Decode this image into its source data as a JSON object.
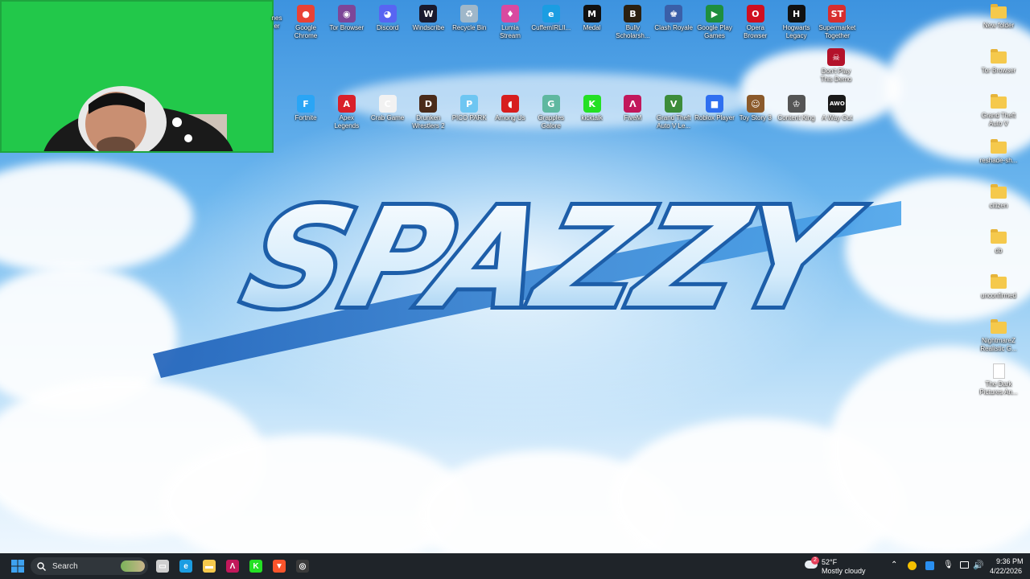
{
  "wallpaper": {
    "logo_text": "SPAZZY"
  },
  "desktop_icons_row1": [
    {
      "label": "Google\nChrome",
      "icon": "chrome-icon",
      "color": "#e94235",
      "glyph": "●"
    },
    {
      "label": "Tor Browser",
      "icon": "tor-icon",
      "color": "#7d4698",
      "glyph": "◉"
    },
    {
      "label": "Discord",
      "icon": "discord-icon",
      "color": "#5865f2",
      "glyph": "◕"
    },
    {
      "label": "Windscribe",
      "icon": "windscribe-icon",
      "color": "#1a1a2e",
      "glyph": "W"
    },
    {
      "label": "Recycle Bin",
      "icon": "recycle-bin-icon",
      "color": "#9fb7c9",
      "glyph": "♻"
    },
    {
      "label": "Lumia\nStream",
      "icon": "lumia-icon",
      "color": "#d94aa0",
      "glyph": "♦"
    },
    {
      "label": "CuffemIRLlI...",
      "icon": "edge-icon",
      "color": "#1b9de2",
      "glyph": "e"
    },
    {
      "label": "Medal",
      "icon": "medal-icon",
      "color": "#111111",
      "glyph": "M"
    },
    {
      "label": "Bully\nScholarsh...",
      "icon": "bully-icon",
      "color": "#2b2010",
      "glyph": "B"
    },
    {
      "label": "Clash Royale",
      "icon": "clash-royale-icon",
      "color": "#3a5fa8",
      "glyph": "♚"
    },
    {
      "label": "Google Play\nGames",
      "icon": "play-games-icon",
      "color": "#1e8e3e",
      "glyph": "▶"
    },
    {
      "label": "Opera\nBrowser",
      "icon": "opera-icon",
      "color": "#d00f1f",
      "glyph": "O"
    },
    {
      "label": "Hogwarts\nLegacy",
      "icon": "hogwarts-icon",
      "color": "#111111",
      "glyph": "H"
    },
    {
      "label": "Supermarket\nTogether",
      "icon": "supermarket-icon",
      "color": "#d82e2e",
      "glyph": "ST"
    }
  ],
  "desktop_icons_row2": [
    {
      "label": "Fortnite",
      "icon": "fortnite-icon",
      "color": "#2aa5f5",
      "glyph": "F"
    },
    {
      "label": "Apex\nLegends",
      "icon": "apex-icon",
      "color": "#d9202a",
      "glyph": "A"
    },
    {
      "label": "Crab Game",
      "icon": "crab-game-icon",
      "color": "#f2f2f2",
      "glyph": "C"
    },
    {
      "label": "Drunken\nWrestlers 2",
      "icon": "drunken-wrestlers-icon",
      "color": "#4a2b1a",
      "glyph": "D"
    },
    {
      "label": "PICO PARK",
      "icon": "pico-park-icon",
      "color": "#6ec6f2",
      "glyph": "P"
    },
    {
      "label": "Among Us",
      "icon": "among-us-icon",
      "color": "#d71e1e",
      "glyph": "◖"
    },
    {
      "label": "Grapples\nGalore",
      "icon": "grapples-icon",
      "color": "#5fb8a0",
      "glyph": "G"
    },
    {
      "label": "kicktalk",
      "icon": "kicktalk-icon",
      "color": "#24e024",
      "glyph": "K"
    },
    {
      "label": "FiveM",
      "icon": "fivem-icon",
      "color": "#c2185b",
      "glyph": "Λ"
    },
    {
      "label": "Grand Theft\nAuto V Le...",
      "icon": "gta-icon",
      "color": "#3d8c3a",
      "glyph": "V"
    },
    {
      "label": "Roblox Player",
      "icon": "roblox-icon",
      "color": "#2f6ff0",
      "glyph": "■"
    },
    {
      "label": "Toy Story 3",
      "icon": "toy-story-icon",
      "color": "#8b5a2b",
      "glyph": "☺"
    },
    {
      "label": "Content King",
      "icon": "content-king-icon",
      "color": "#555555",
      "glyph": "♔"
    },
    {
      "label": "A Way Out",
      "icon": "a-way-out-icon",
      "color": "#1a1a1a",
      "glyph": "AWO"
    }
  ],
  "desktop_icons_right": [
    {
      "label": "New folder",
      "type": "folder"
    },
    {
      "label": "Tor Browser",
      "type": "folder"
    },
    {
      "label": "Grand Theft\nAuto V",
      "type": "folder"
    },
    {
      "label": "reshade-sh...",
      "type": "folder"
    },
    {
      "label": "citizen",
      "type": "folder"
    },
    {
      "label": "db",
      "type": "folder"
    },
    {
      "label": "unconfirmed",
      "type": "folder"
    },
    {
      "label": "NightmareZ\nRealistic G...",
      "type": "folder"
    },
    {
      "label": "The Dark\nPictures An...",
      "type": "doc"
    }
  ],
  "extra_icon": {
    "label": "Don't Play\nThis Demo",
    "icon": "dont-play-icon",
    "color": "#b3122a",
    "glyph": "☠"
  },
  "cut_label_left": "nes\ner",
  "taskbar": {
    "search_placeholder": "Search",
    "weather_temp": "52°F",
    "weather_desc": "Mostly cloudy",
    "weather_badge": "2",
    "time": "9:36 PM",
    "date": "4/22/2026"
  },
  "taskbar_apps": [
    {
      "icon": "task-view-icon",
      "color": "#cfcfcf",
      "glyph": "▭"
    },
    {
      "icon": "edge-icon",
      "color": "#1b9de2",
      "glyph": "e"
    },
    {
      "icon": "file-explorer-icon",
      "color": "#f5c94c",
      "glyph": "▬"
    },
    {
      "icon": "fivem-icon",
      "color": "#c2185b",
      "glyph": "Λ"
    },
    {
      "icon": "kick-icon",
      "color": "#24e024",
      "glyph": "K"
    },
    {
      "icon": "brave-icon",
      "color": "#fb542b",
      "glyph": "▼"
    },
    {
      "icon": "obs-icon",
      "color": "#3a3a3a",
      "glyph": "◎"
    }
  ]
}
